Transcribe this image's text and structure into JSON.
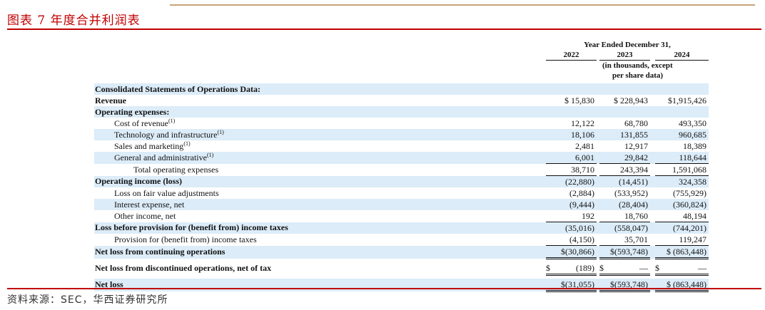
{
  "figure_title": "图表 7 年度合并利润表",
  "source": "资料来源：SEC，华西证券研究所",
  "header": {
    "period": "Year Ended December 31,",
    "years": [
      "2022",
      "2023",
      "2024"
    ],
    "units_line1": "(in thousands, except",
    "units_line2": "per share data)"
  },
  "rows": [
    {
      "label": "Consolidated Statements of Operations Data:",
      "v": [
        "",
        "",
        ""
      ]
    },
    {
      "label": "Revenue",
      "v": [
        "$ 15,830",
        "$ 228,943",
        "$1,915,426"
      ]
    },
    {
      "label": "Operating expenses:",
      "v": [
        "",
        "",
        ""
      ]
    },
    {
      "label": "Cost of revenue",
      "note": "(1)",
      "v": [
        "12,122",
        "68,780",
        "493,350"
      ]
    },
    {
      "label": "Technology and infrastructure",
      "note": "(1)",
      "v": [
        "18,106",
        "131,855",
        "960,685"
      ]
    },
    {
      "label": "Sales and marketing",
      "note": "(1)",
      "v": [
        "2,481",
        "12,917",
        "18,389"
      ]
    },
    {
      "label": "General and administrative",
      "note": "(1)",
      "v": [
        "6,001",
        "29,842",
        "118,644"
      ]
    },
    {
      "label": "Total operating expenses",
      "v": [
        "38,710",
        "243,394",
        "1,591,068"
      ]
    },
    {
      "label": "Operating income (loss)",
      "v": [
        "(22,880)",
        "(14,451)",
        "324,358"
      ]
    },
    {
      "label": "Loss on fair value adjustments",
      "v": [
        "(2,884)",
        "(533,952)",
        "(755,929)"
      ]
    },
    {
      "label": "Interest expense, net",
      "v": [
        "(9,444)",
        "(28,404)",
        "(360,824)"
      ]
    },
    {
      "label": "Other income, net",
      "v": [
        "192",
        "18,760",
        "48,194"
      ]
    },
    {
      "label": "Loss before provision for (benefit from) income taxes",
      "v": [
        "(35,016)",
        "(558,047)",
        "(744,201)"
      ]
    },
    {
      "label": "Provision for (benefit from) income taxes",
      "v": [
        "(4,150)",
        "35,701",
        "119,247"
      ]
    },
    {
      "label": "Net loss from continuing operations",
      "v": [
        "$(30,866)",
        "$(593,748)",
        "$ (863,448)"
      ]
    },
    {
      "label": "Net loss from discontinued operations, net of tax",
      "v": [
        [
          "$",
          "(189)"
        ],
        [
          "$",
          "—"
        ],
        [
          "$",
          "—"
        ]
      ]
    },
    {
      "label": "Net loss",
      "v": [
        "$(31,055)",
        "$(593,748)",
        "$ (863,448)"
      ]
    }
  ]
}
